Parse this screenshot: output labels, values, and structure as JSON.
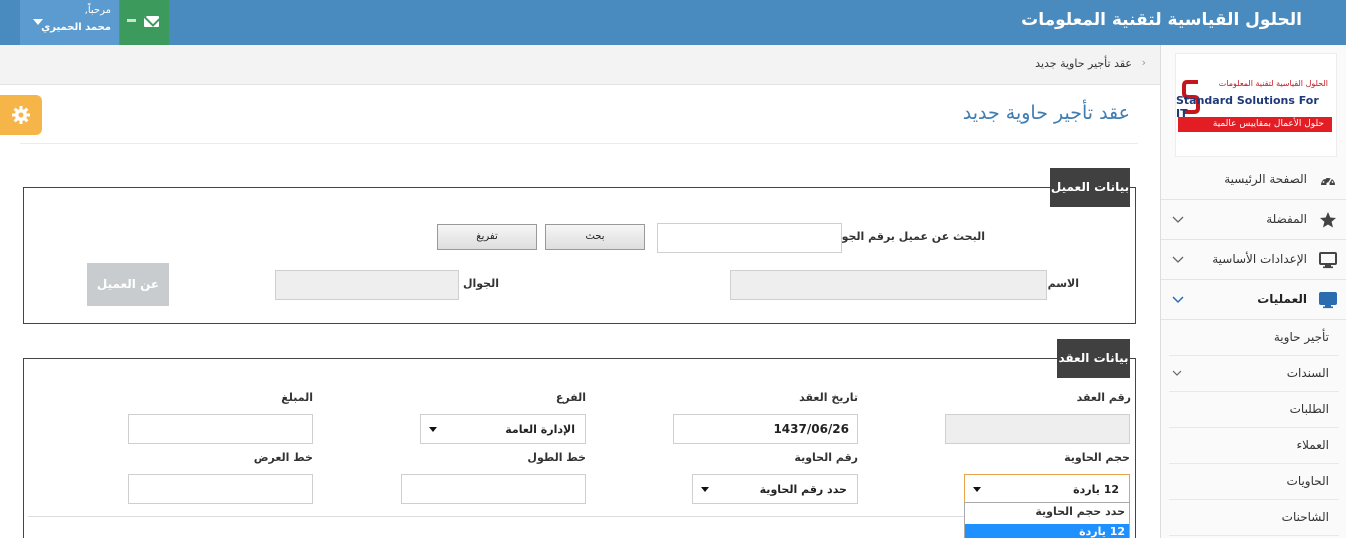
{
  "header": {
    "brand": "الحلول القياسية لتقنية المعلومات",
    "greeting": "مرحباً,",
    "user_name": "محمد الحميري"
  },
  "breadcrumb": {
    "current": "عقد تأجير حاوية جديد"
  },
  "page": {
    "title": "عقد تأجير حاوية جديد"
  },
  "logo": {
    "arabic": "الحلول القياسية لتقنية المعلومات",
    "english": "Standard Solutions For IT",
    "tagline": "حلول الأعمال بمقاييس عالمية"
  },
  "sidebar": {
    "items": [
      {
        "label": "الصفحة الرئيسية",
        "icon": "dashboard-icon"
      },
      {
        "label": "المفضلة",
        "icon": "star-icon"
      },
      {
        "label": "الإعدادات الأساسية",
        "icon": "monitor-icon"
      },
      {
        "label": "العمليات",
        "icon": "monitor-icon"
      }
    ],
    "subitems": [
      {
        "label": "تأجير حاوية"
      },
      {
        "label": "السندات"
      },
      {
        "label": "الطلبات"
      },
      {
        "label": "العملاء"
      },
      {
        "label": "الحاويات"
      },
      {
        "label": "الشاحنات"
      }
    ]
  },
  "customer": {
    "section_title": "بيانات العميل",
    "search_label": "البحث عن عميل برقم الجوال",
    "search_value": "",
    "search_button": "بحث",
    "clear_button": "تفريغ",
    "name_label": "الاسم",
    "name_value": "",
    "mobile_label": "الجوال",
    "mobile_value": "",
    "about_button": "عن العميل"
  },
  "contract": {
    "section_title": "بيانات العقد",
    "number_label": "رقم العقد",
    "number_value": "",
    "date_label": "تاريخ العقد",
    "date_value": "1437/06/26",
    "branch_label": "الفرع",
    "branch_value": "الإدارة العامة",
    "amount_label": "المبلغ",
    "amount_value": "",
    "size_label": "حجم الحاوية",
    "size_value": "12 ياردة",
    "container_label": "رقم الحاوية",
    "container_value": "حدد رقم الحاوية",
    "longitude_label": "خط الطول",
    "longitude_value": "",
    "latitude_label": "خط العرض",
    "latitude_value": "",
    "size_options": [
      "حدد حجم الحاوية",
      "12 ياردة"
    ]
  },
  "colors": {
    "topbar": "#4a8bbf",
    "title": "#3f7cb0",
    "section_tab": "#404040",
    "settings": "#f6b549",
    "mail": "#3b9a5c",
    "option_selected": "#1e90ff"
  }
}
